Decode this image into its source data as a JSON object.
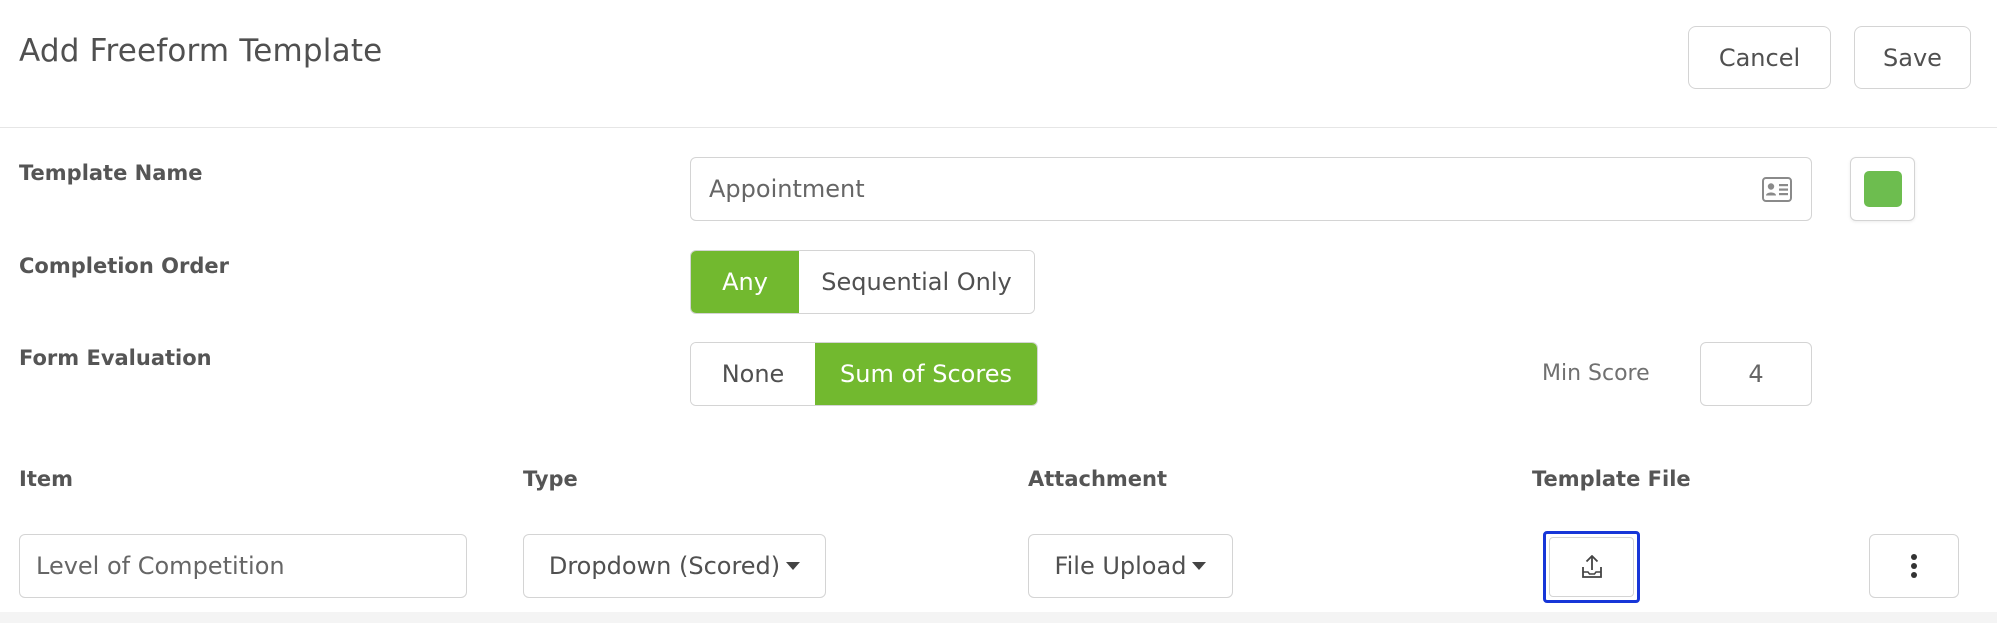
{
  "header": {
    "title": "Add Freeform Template",
    "cancel_label": "Cancel",
    "save_label": "Save"
  },
  "form": {
    "template_name": {
      "label": "Template Name",
      "value": "Appointment",
      "icon": "contact-card-icon",
      "color": "#6dbd4f"
    },
    "completion_order": {
      "label": "Completion Order",
      "options": [
        "Any",
        "Sequential Only"
      ],
      "selected": "Any"
    },
    "form_evaluation": {
      "label": "Form Evaluation",
      "options": [
        "None",
        "Sum of Scores"
      ],
      "selected": "Sum of Scores",
      "min_score_label": "Min Score",
      "min_score_value": "4"
    }
  },
  "items": {
    "columns": [
      "Item",
      "Type",
      "Attachment",
      "Template File"
    ],
    "rows": [
      {
        "item": "Level of Competition",
        "type": "Dropdown (Scored)",
        "attachment": "File Upload",
        "template_file_icon": "upload-icon",
        "menu_icon": "more-vertical-icon"
      }
    ]
  },
  "colors": {
    "accent": "#72b92f",
    "focus": "#1736d8"
  }
}
